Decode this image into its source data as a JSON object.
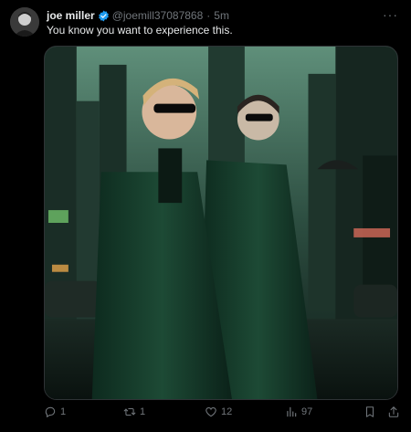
{
  "post": {
    "author_name": "joe miller",
    "handle": "@joemill37087868",
    "separator": "·",
    "time": "5m",
    "text": "You know you want to experience this.",
    "more_label": "···",
    "verified_color": "#1d9bf0",
    "media": {
      "type": "image",
      "subject": "two men in long dark green trench coats and sunglasses on a rainy neon-lit city street"
    },
    "actions": {
      "replies": "1",
      "reposts": "1",
      "likes": "12",
      "views": "97"
    },
    "icons": [
      "reply-icon",
      "repost-icon",
      "like-icon",
      "views-icon",
      "bookmark-icon",
      "share-icon"
    ]
  }
}
